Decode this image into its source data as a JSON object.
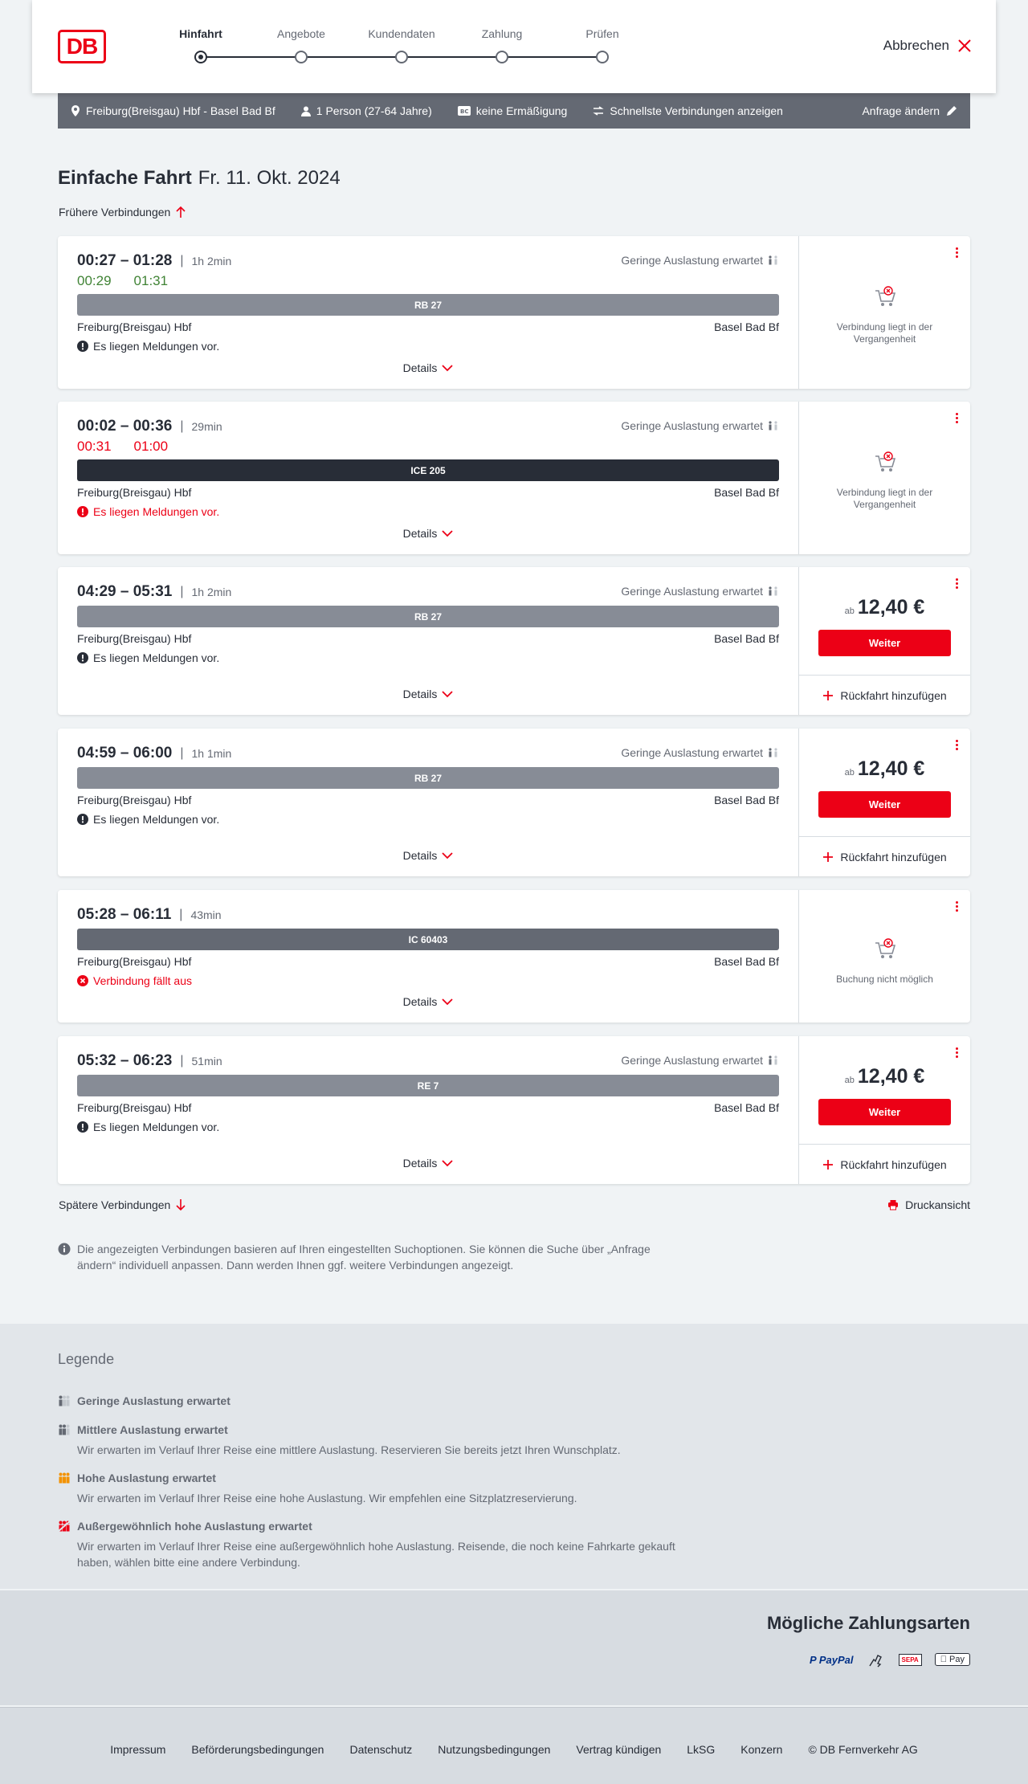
{
  "header": {
    "logo": "DB",
    "steps": [
      "Hinfahrt",
      "Angebote",
      "Kundendaten",
      "Zahlung",
      "Prüfen"
    ],
    "cancel": "Abbrechen"
  },
  "search": {
    "route": "Freiburg(Breisgau) Hbf - Basel Bad Bf",
    "persons": "1 Person (27-64 Jahre)",
    "discount": "keine Ermäßigung",
    "fastest": "Schnellste Verbindungen anzeigen",
    "change": "Anfrage ändern"
  },
  "title": {
    "kind": "Einfache Fahrt",
    "date": "Fr. 11. Okt. 2024"
  },
  "earlier": "Frühere Verbindungen",
  "later": "Spätere Verbindungen",
  "print": "Druckansicht",
  "connections": [
    {
      "dep": "00:27",
      "arr": "01:28",
      "duration": "1h 2min",
      "occupancy": "Geringe Auslastung erwartet",
      "rt_dep": "00:29",
      "rt_arr": "01:31",
      "rt_color": "green",
      "train": "RB 27",
      "train_color": "#878c96",
      "from": "Freiburg(Breisgau) Hbf",
      "to": "Basel Bad Bf",
      "message": "Es liegen Meldungen vor.",
      "msg_style": "dark",
      "details": "Details",
      "state": "past",
      "state_text": "Verbindung liegt in der Vergangenheit"
    },
    {
      "dep": "00:02",
      "arr": "00:36",
      "duration": "29min",
      "occupancy": "Geringe Auslastung erwartet",
      "rt_dep": "00:31",
      "rt_arr": "01:00",
      "rt_color": "red",
      "train": "ICE 205",
      "train_color": "#282d37",
      "from": "Freiburg(Breisgau) Hbf",
      "to": "Basel Bad Bf",
      "message": "Es liegen Meldungen vor.",
      "msg_style": "red",
      "details": "Details",
      "state": "past",
      "state_text": "Verbindung liegt in der Vergangenheit"
    },
    {
      "dep": "04:29",
      "arr": "05:31",
      "duration": "1h 2min",
      "occupancy": "Geringe Auslastung erwartet",
      "train": "RB 27",
      "train_color": "#878c96",
      "from": "Freiburg(Breisgau) Hbf",
      "to": "Basel Bad Bf",
      "message": "Es liegen Meldungen vor.",
      "msg_style": "dark",
      "details": "Details",
      "state": "price",
      "price_prefix": "ab",
      "price": "12,40 €",
      "button": "Weiter",
      "return": "Rückfahrt hinzufügen"
    },
    {
      "dep": "04:59",
      "arr": "06:00",
      "duration": "1h 1min",
      "occupancy": "Geringe Auslastung erwartet",
      "train": "RB 27",
      "train_color": "#878c96",
      "from": "Freiburg(Breisgau) Hbf",
      "to": "Basel Bad Bf",
      "message": "Es liegen Meldungen vor.",
      "msg_style": "dark",
      "details": "Details",
      "state": "price",
      "price_prefix": "ab",
      "price": "12,40 €",
      "button": "Weiter",
      "return": "Rückfahrt hinzufügen"
    },
    {
      "dep": "05:28",
      "arr": "06:11",
      "duration": "43min",
      "train": "IC 60403",
      "train_color": "#646973",
      "from": "Freiburg(Breisgau) Hbf",
      "to": "Basel Bad Bf",
      "message": "Verbindung fällt aus",
      "msg_style": "cancel",
      "details": "Details",
      "state": "na",
      "state_text": "Buchung nicht möglich"
    },
    {
      "dep": "05:32",
      "arr": "06:23",
      "duration": "51min",
      "occupancy": "Geringe Auslastung erwartet",
      "train": "RE 7",
      "train_color": "#878c96",
      "from": "Freiburg(Breisgau) Hbf",
      "to": "Basel Bad Bf",
      "message": "Es liegen Meldungen vor.",
      "msg_style": "dark",
      "details": "Details",
      "state": "price",
      "price_prefix": "ab",
      "price": "12,40 €",
      "button": "Weiter",
      "return": "Rückfahrt hinzufügen"
    }
  ],
  "info": "Die angezeigten Verbindungen basieren auf Ihren eingestellten Suchoptionen. Sie können die Suche über „Anfrage ändern“ individuell anpassen. Dann werden Ihnen ggf. weitere Verbindungen angezeigt.",
  "legend": {
    "title": "Legende",
    "items": [
      {
        "title": "Geringe Auslastung erwartet",
        "desc": ""
      },
      {
        "title": "Mittlere Auslastung erwartet",
        "desc": "Wir erwarten im Verlauf Ihrer Reise eine mittlere Auslastung. Reservieren Sie bereits jetzt Ihren Wunschplatz."
      },
      {
        "title": "Hohe Auslastung erwartet",
        "desc": "Wir erwarten im Verlauf Ihrer Reise eine hohe Auslastung. Wir empfehlen eine Sitzplatzreservierung."
      },
      {
        "title": "Außergewöhnlich hohe Auslastung erwartet",
        "desc": "Wir erwarten im Verlauf Ihrer Reise eine außergewöhnlich hohe Auslastung. Reisende, die noch keine Fahrkarte gekauft haben, wählen bitte eine andere Verbindung."
      }
    ]
  },
  "payment": {
    "title": "Mögliche Zahlungsarten",
    "methods": [
      "PayPal",
      "SEPA",
      "Pay"
    ]
  },
  "footer": [
    "Impressum",
    "Beförderungsbedingungen",
    "Datenschutz",
    "Nutzungsbedingungen",
    "Vertrag kündigen",
    "LkSG",
    "Konzern",
    "© DB Fernverkehr AG"
  ]
}
